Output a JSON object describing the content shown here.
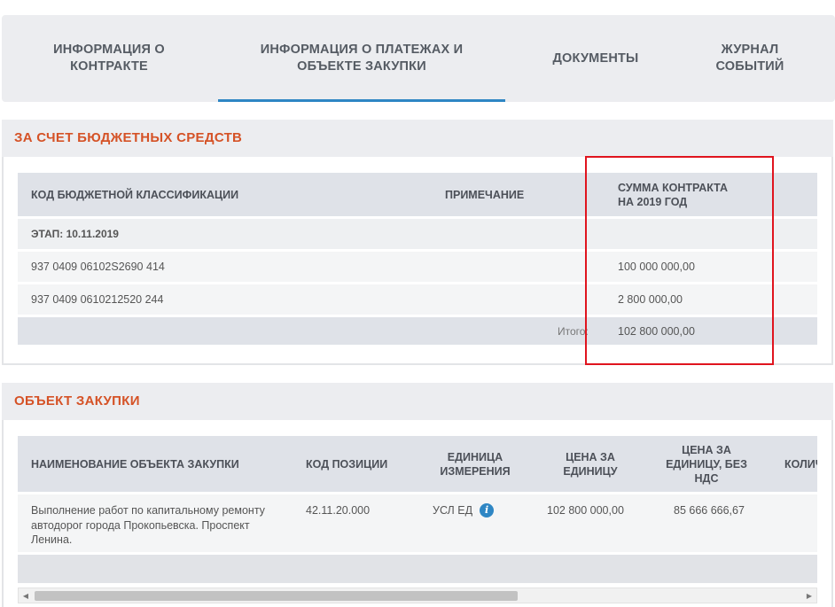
{
  "tabs": [
    {
      "label": "Информация о контракте"
    },
    {
      "label": "Информация о платежах и объекте закупки"
    },
    {
      "label": "Документы"
    },
    {
      "label": "Журнал событий"
    }
  ],
  "budget_section": {
    "title": "За счет бюджетных средств",
    "headers": {
      "code": "Код бюджетной классификации",
      "note": "Примечание",
      "sum": "Сумма контракта на 2019 год"
    },
    "stage": "ЭТАП: 10.11.2019",
    "rows": [
      {
        "code": "937 0409 06102S2690 414",
        "note": "",
        "sum": "100 000 000,00"
      },
      {
        "code": "937 0409 0610212520 244",
        "note": "",
        "sum": "2 800 000,00"
      }
    ],
    "total_label": "Итого:",
    "total_value": "102 800 000,00"
  },
  "purchase_section": {
    "title": "Объект закупки",
    "headers": {
      "name": "Наименование объекта закупки",
      "position_code": "Код позиции",
      "unit": "Единица измерения",
      "price": "Цена за единицу",
      "price_no_vat": "Цена за единицу, без НДС",
      "qty": "Количество"
    },
    "rows": [
      {
        "name": "Выполнение работ по капитальному ремонту автодорог города Прокопьевска. Проспект Ленина.",
        "position_code": "42.11.20.000",
        "unit": "УСЛ ЕД",
        "price": "102 800 000,00",
        "price_no_vat": "85 666 666,67"
      }
    ]
  },
  "icons": {
    "info": "info-icon",
    "scroll_left": "arrow-left-icon",
    "scroll_right": "arrow-right-icon"
  },
  "colors": {
    "accent": "#2e86c4",
    "section_title": "#d55226",
    "highlight": "#e0141e"
  }
}
